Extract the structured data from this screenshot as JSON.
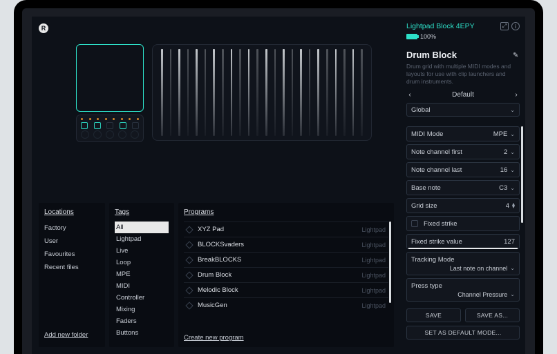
{
  "header": {
    "device_name": "Lightpad Block 4EPY",
    "battery_pct": "100%"
  },
  "program": {
    "title": "Drum Block",
    "description": "Drum grid with multiple MIDI modes and layouts for use with clip launchers and drum instruments.",
    "preset_name": "Default",
    "scope": "Global"
  },
  "params": {
    "midi_mode": {
      "label": "MIDI Mode",
      "value": "MPE"
    },
    "note_first": {
      "label": "Note channel first",
      "value": "2"
    },
    "note_last": {
      "label": "Note channel last",
      "value": "16"
    },
    "base_note": {
      "label": "Base note",
      "value": "C3"
    },
    "grid_size": {
      "label": "Grid size",
      "value": "4"
    },
    "fixed_strike": {
      "label": "Fixed strike"
    },
    "fixed_strike_value": {
      "label": "Fixed strike value",
      "value": "127"
    },
    "tracking_mode": {
      "label": "Tracking Mode",
      "value": "Last note on channel"
    },
    "press_type": {
      "label": "Press type",
      "value": "Channel Pressure"
    }
  },
  "actions": {
    "save": "SAVE",
    "save_as": "SAVE AS...",
    "set_default": "SET AS DEFAULT MODE..."
  },
  "browser": {
    "locations_h": "Locations",
    "locations": [
      "Factory",
      "User",
      "Favourites",
      "Recent files"
    ],
    "add_folder": "Add new folder",
    "tags_h": "Tags",
    "tags": [
      "All",
      "Lightpad",
      "Live",
      "Loop",
      "MPE",
      "MIDI",
      "Controller",
      "Mixing",
      "Faders",
      "Buttons"
    ],
    "selected_tag": "All",
    "programs_h": "Programs",
    "programs": [
      {
        "name": "XYZ Pad",
        "kind": "Lightpad"
      },
      {
        "name": "BLOCKSvaders",
        "kind": "Lightpad"
      },
      {
        "name": "BreakBLOCKS",
        "kind": "Lightpad"
      },
      {
        "name": "Drum Block",
        "kind": "Lightpad"
      },
      {
        "name": "Melodic Block",
        "kind": "Lightpad"
      },
      {
        "name": "MusicGen",
        "kind": "Lightpad"
      }
    ],
    "create_program": "Create new program"
  }
}
